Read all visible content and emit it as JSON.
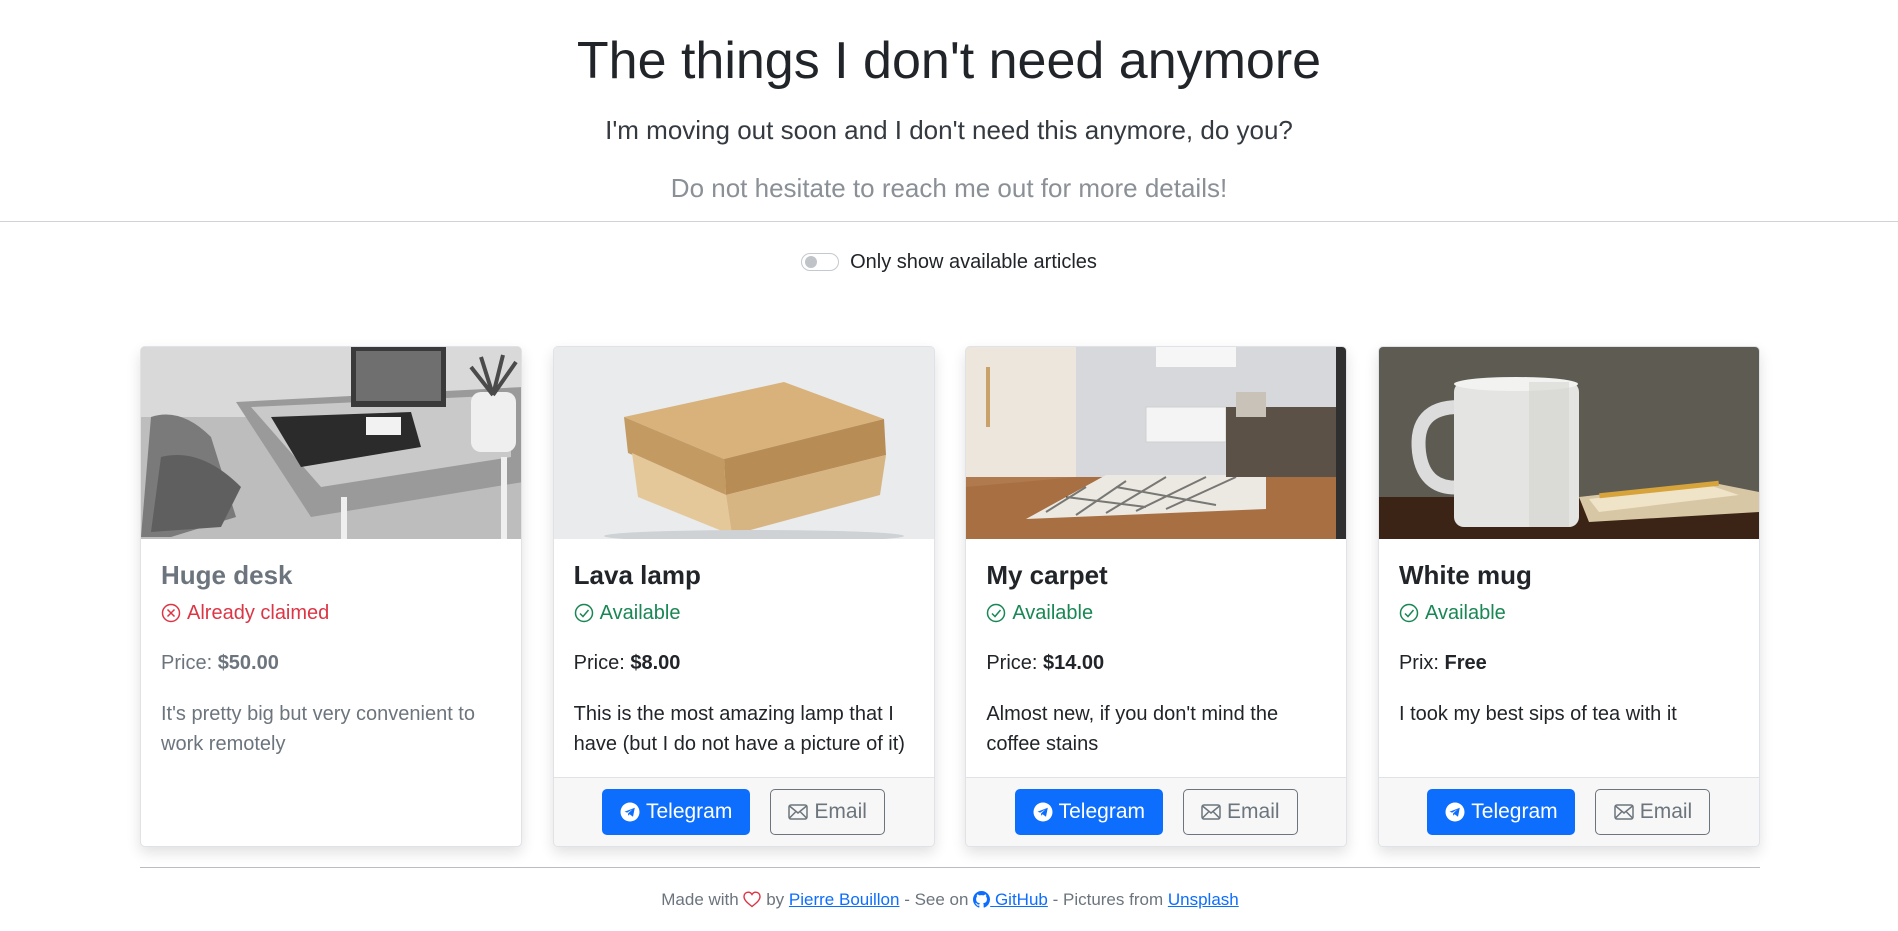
{
  "header": {
    "title": "The things I don't need anymore",
    "lead": "I'm moving out soon and I don't need this anymore, do you?",
    "note": "Do not hesitate to reach me out for more details!"
  },
  "filter": {
    "label": "Only show available articles",
    "checked": false
  },
  "cards": [
    {
      "title": "Huge desk",
      "status": "Already claimed",
      "price_label": "Price:",
      "price": "$50.00",
      "description": "It's pretty big but very convenient to work remotely"
    },
    {
      "title": "Lava lamp",
      "status": "Available",
      "price_label": "Price:",
      "price": "$8.00",
      "description": "This is the most amazing lamp that I have (but I do not have a picture of it)",
      "telegram": "Telegram",
      "email": "Email"
    },
    {
      "title": "My carpet",
      "status": "Available",
      "price_label": "Price:",
      "price": "$14.00",
      "description": "Almost new, if you don't mind the coffee stains",
      "telegram": "Telegram",
      "email": "Email"
    },
    {
      "title": "White mug",
      "status": "Available",
      "price_label": "Prix:",
      "price": "Free",
      "description": "I took my best sips of tea with it",
      "telegram": "Telegram",
      "email": "Email"
    }
  ],
  "footer": {
    "made_with": "Made with",
    "by": "by",
    "author": "Pierre Bouillon",
    "see_on": "- See on",
    "github": "GitHub",
    "pictures_from": "- Pictures from",
    "unsplash": "Unsplash"
  },
  "colors": {
    "primary": "#0d6efd",
    "success": "#198754",
    "danger": "#dc3545",
    "muted": "#6c757d"
  }
}
